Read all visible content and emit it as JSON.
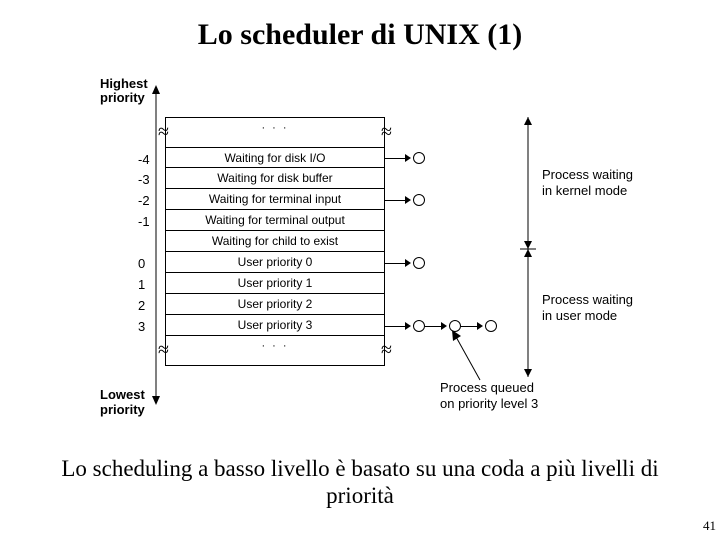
{
  "title": "Lo scheduler di UNIX (1)",
  "labels": {
    "highest": "Highest\npriority",
    "lowest": "Lowest\npriority"
  },
  "rows": [
    {
      "num": "-4",
      "text": "Waiting for disk I/O"
    },
    {
      "num": "-3",
      "text": "Waiting for disk buffer"
    },
    {
      "num": "-2",
      "text": "Waiting for terminal input"
    },
    {
      "num": "-1",
      "text": "Waiting for terminal output"
    },
    {
      "num": "",
      "text": "Waiting for child to exist"
    },
    {
      "num": "0",
      "text": "User priority 0"
    },
    {
      "num": "1",
      "text": "User priority 1"
    },
    {
      "num": "2",
      "text": "User priority 2"
    },
    {
      "num": "3",
      "text": "User priority 3"
    }
  ],
  "regions": {
    "kernel": "Process waiting\nin kernel mode",
    "user": "Process waiting\nin user mode",
    "queued": "Process queued\non priority level 3"
  },
  "caption": "Lo scheduling a basso livello è basato su una coda a più livelli di priorità",
  "page": "41"
}
